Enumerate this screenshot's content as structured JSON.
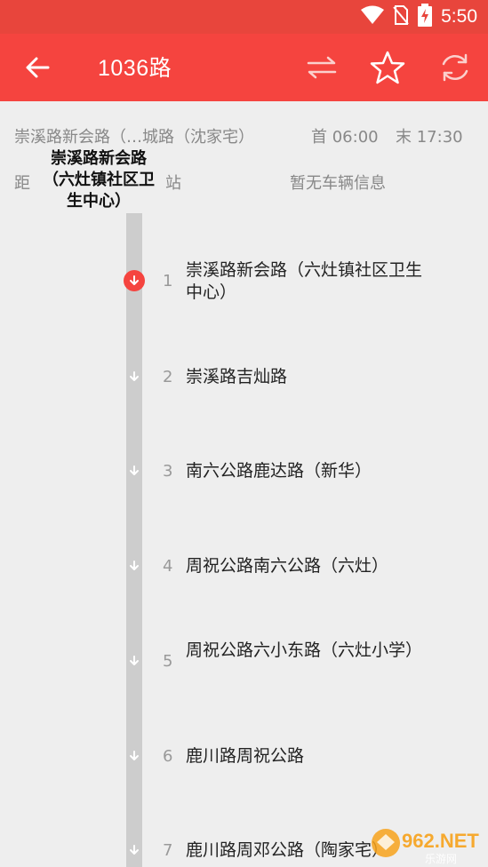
{
  "status_bar": {
    "time": "5:50",
    "icons": [
      "wifi-icon",
      "no-sim-icon",
      "battery-charging-icon"
    ]
  },
  "app_bar": {
    "title": "1036路",
    "back_icon": "arrow-left-icon",
    "swap_icon": "swap-direction-icon",
    "favorite_icon": "star-outline-icon",
    "refresh_icon": "refresh-icon"
  },
  "route_info": {
    "route_text": "崇溪路新会路（…城路（沈家宅）",
    "first_bus": "首 06:00",
    "last_bus": "末 17:30",
    "distance_label": "距",
    "selected_station": "崇溪路新会路（六灶镇社区卫生中心）",
    "station_label": "站",
    "vehicle_status": "暂无车辆信息"
  },
  "stops": [
    {
      "num": "1",
      "name": "崇溪路新会路（六灶镇社区卫生中心）",
      "active": true
    },
    {
      "num": "2",
      "name": "崇溪路吉灿路",
      "active": false
    },
    {
      "num": "3",
      "name": "南六公路鹿达路（新华）",
      "active": false
    },
    {
      "num": "4",
      "name": "周祝公路南六公路（六灶）",
      "active": false
    },
    {
      "num": "5",
      "name": "周祝公路六小东路（六灶小学）",
      "active": false
    },
    {
      "num": "6",
      "name": "鹿川路周祝公路",
      "active": false
    },
    {
      "num": "7",
      "name": "鹿川路周邓公路（陶家宅）",
      "active": false
    }
  ],
  "watermark": {
    "brand": "962.NET",
    "subtitle": "乐游网"
  },
  "colors": {
    "primary": "#f5443f",
    "status_bar": "#e8453c",
    "background": "#eeeeee",
    "track": "#cdcdcd"
  }
}
